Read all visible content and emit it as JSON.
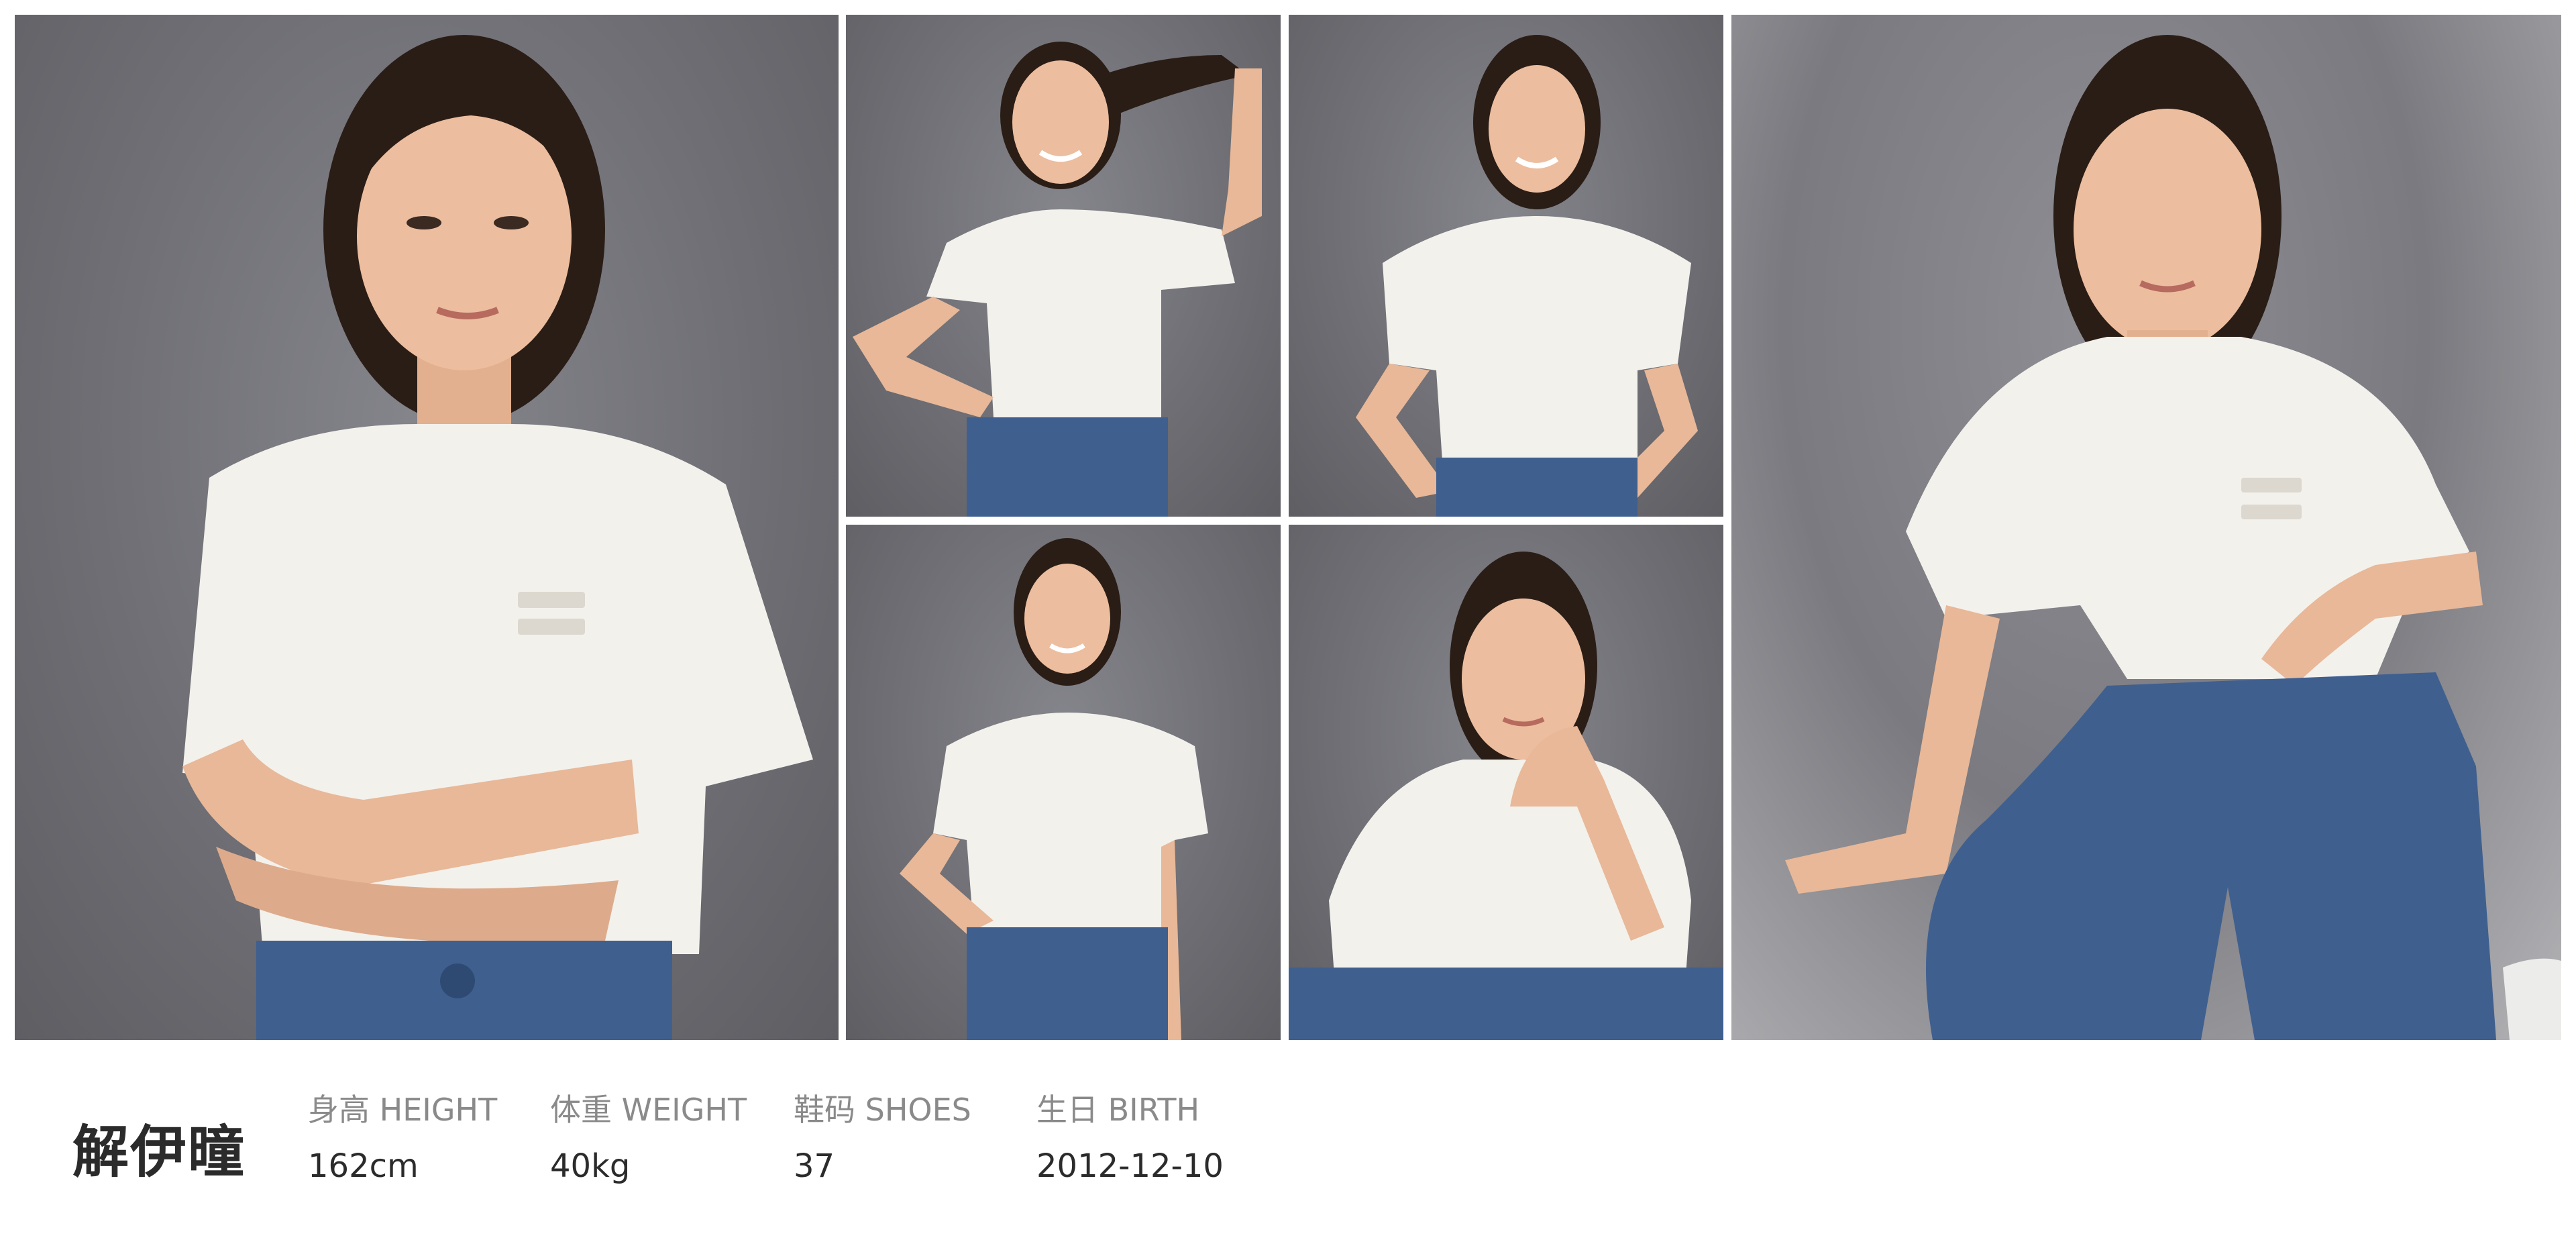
{
  "profile": {
    "name": "解伊曈",
    "specs": {
      "height": {
        "label": "身高 HEIGHT",
        "value": "162cm"
      },
      "weight": {
        "label": "体重 WEIGHT",
        "value": "40kg"
      },
      "shoes": {
        "label": "鞋码 SHOES",
        "value": "37"
      },
      "birth": {
        "label": "生日 BIRTH",
        "value": "2012-12-10"
      }
    }
  },
  "colors": {
    "backdrop": "#6f6f75",
    "tshirt": "#f3f1ec",
    "jeans": "#3f5f8f",
    "skin": "#e8b898",
    "hair": "#2a1d16",
    "text_dark": "#2b2b2b",
    "text_muted": "#8a8a8a"
  },
  "photos": [
    {
      "pose": "arms-crossed-portrait"
    },
    {
      "pose": "hand-on-hip-holding-hair"
    },
    {
      "pose": "hands-on-waist-smiling"
    },
    {
      "pose": "hand-on-hip-full-body"
    },
    {
      "pose": "chin-on-hand-seated"
    },
    {
      "pose": "seated-on-floor"
    }
  ]
}
